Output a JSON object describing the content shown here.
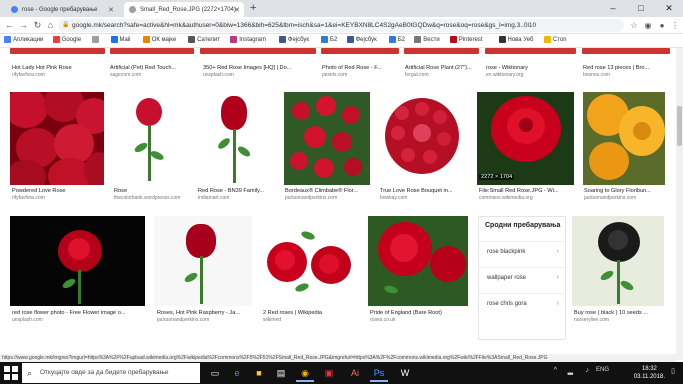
{
  "tabs": [
    {
      "title": "rose - Google пребарување",
      "active": false
    },
    {
      "title": "Small_Red_Rose.JPG (2272×1704)",
      "active": true
    }
  ],
  "new_tab": "+",
  "window_controls": {
    "minimize": "–",
    "maximize": "□",
    "close": "✕"
  },
  "omnibox": {
    "url": "google.mk/search?safe=active&hl=mk&authuser=0&biw=1366&bih=625&tbm=isch&sa=1&ei=KEYBXN8LC4S2gAeB0tGQDw&q=rose&oq=rose&gs_l=img.3..0l10",
    "lock": "🔒"
  },
  "bookmarks": [
    {
      "label": "Апликации",
      "color": "#4285f4"
    },
    {
      "label": "Google",
      "color": "#ea4335"
    },
    {
      "label": "",
      "color": "#9e9e9e"
    },
    {
      "label": "Mail",
      "color": "#1a73e8"
    },
    {
      "label": "ОК мајке",
      "color": "#ee8208"
    },
    {
      "label": "Сателит",
      "color": "#555555"
    },
    {
      "label": "Instagram",
      "color": "#c13584"
    },
    {
      "label": "Фејсбук",
      "color": "#3b5998"
    },
    {
      "label": "Б2",
      "color": "#2d7dd2"
    },
    {
      "label": "Фејсбук",
      "color": "#3b5998"
    },
    {
      "label": "Б2",
      "color": "#2d7dd2"
    },
    {
      "label": "Вести",
      "color": "#777777"
    },
    {
      "label": "Pinterest",
      "color": "#bd081c"
    },
    {
      "label": "Нова Уеб",
      "color": "#333333"
    },
    {
      "label": "Стоп",
      "color": "#f4b400"
    }
  ],
  "row0": [
    {
      "caption": "Hot Lady Hot Pink Rose",
      "source": "rifyfavfora.com"
    },
    {
      "caption": "Artificial (Pet) Red Touch...",
      "source": "sagecom.com"
    },
    {
      "caption": "350+ Red Rose Images [HQ] | Do...",
      "source": "unsplash.com"
    },
    {
      "caption": "Photo of Red Rose - F...",
      "source": "pexels.com"
    },
    {
      "caption": "Artificial Rose Plant (27\")...",
      "source": "fergut.com"
    },
    {
      "caption": "rose - Wiktionary",
      "source": "en.wiktionary.org"
    },
    {
      "caption": "Red rose 13 pieces | Bro...",
      "source": "bosnos.com"
    }
  ],
  "row1": [
    {
      "caption": "Powdered Love Rose",
      "source": "rifyfavfora.com"
    },
    {
      "caption": "Rose",
      "source": "thecolorbank.wordpresss.com"
    },
    {
      "caption": "Red Rose - BN39 Family...",
      "source": "indiamart.com"
    },
    {
      "caption": "Bordeaux® Climbabe® Flor...",
      "source": "jacksonandperkins.com"
    },
    {
      "caption": "True Love Rose Bouquet in...",
      "source": "bowkay.com"
    },
    {
      "caption": "File:Small Red Rose.JPG - Wi...",
      "source": "commons.wikimedia.org"
    },
    {
      "caption": "Soaring to Glory Floribun...",
      "source": "jacksonandperkins.com"
    }
  ],
  "row1_badge": "2272 × 1704",
  "row2": [
    {
      "caption": "red rose flower photo - Free Flower image o...",
      "source": "unsplash.com"
    },
    {
      "caption": "Roses, Hot Pink Raspberry - Ja...",
      "source": "jacksonandperkins.com"
    },
    {
      "caption": "2 Red roses | Wikipedia",
      "source": "wikimed"
    },
    {
      "caption": "Pride of England (Bare Root)",
      "source": "roses.co.uk"
    },
    {
      "caption": "Buy rose ( black ) 10 seeds ...",
      "source": "nurserylive.com"
    }
  ],
  "related": {
    "title": "Сродни пребарувања",
    "items": [
      "rose blackpink",
      "wallpaper rose",
      "rose chris gora"
    ],
    "arrow": "›"
  },
  "status_url": "https://www.google.mk/imgres?imgurl=https%3A%2F%2Fupload.wikimedia.org%2Fwikipedia%2Fcommons%2F5%2F51%2FSmall_Red_Rose.JPG&imgrefurl=https%3A%2F%2Fcommons.wikimedia.org%2Fwiki%2FFile%3ASmall_Red_Rose.JPG",
  "taskbar": {
    "search_placeholder": "Откуцајте овде за да бидете пребарување",
    "time": "18:32",
    "date": "03.11.2018.",
    "lang": "ENG"
  }
}
